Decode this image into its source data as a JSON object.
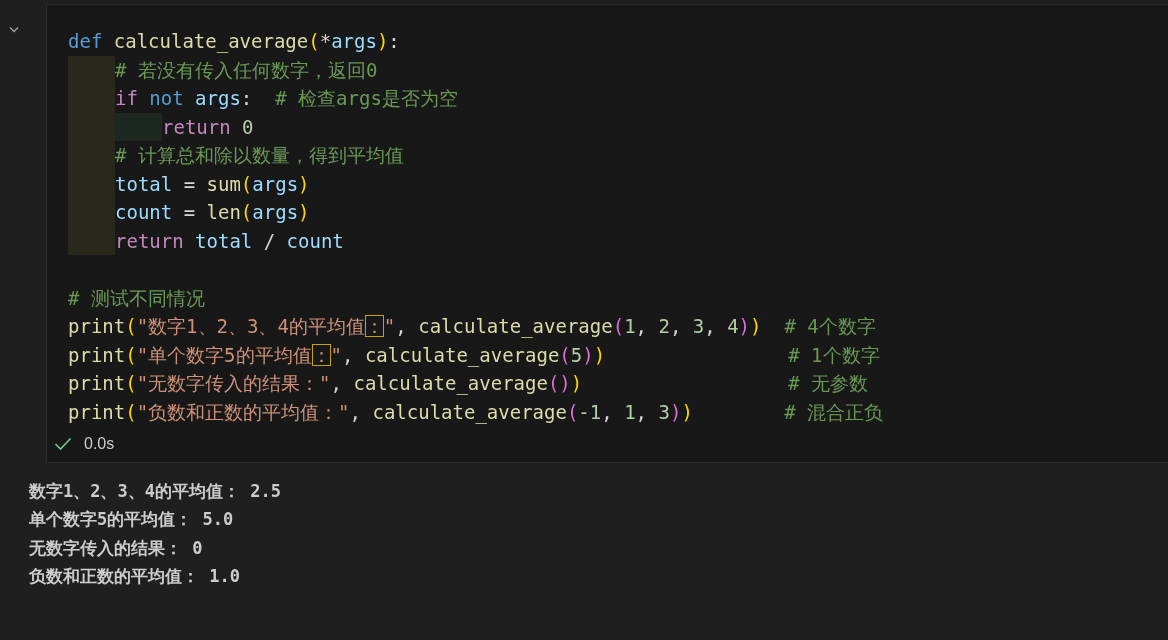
{
  "cell": {
    "blocks": [
      [
        {
          "tokens": [
            {
              "text": "def ",
              "kind": "keyword"
            },
            {
              "text": "calculate_average",
              "kind": "function"
            },
            {
              "text": "(",
              "kind": "bracket1"
            },
            {
              "text": "*",
              "kind": "punct"
            },
            {
              "text": "args",
              "kind": "variable"
            },
            {
              "text": ")",
              "kind": "bracket1"
            },
            {
              "text": ":",
              "kind": "punct"
            }
          ],
          "children": [
            {
              "tokens": [
                {
                  "text": "# 若没有传入任何数字，返回0",
                  "kind": "comment"
                }
              ]
            },
            {
              "tokens": [
                {
                  "text": "if ",
                  "kind": "control"
                },
                {
                  "text": "not ",
                  "kind": "keyword"
                },
                {
                  "text": "args",
                  "kind": "variable"
                },
                {
                  "text": ":  ",
                  "kind": "punct"
                },
                {
                  "text": "# 检查args是否为空",
                  "kind": "comment"
                }
              ],
              "children": [
                {
                  "tokens": [
                    {
                      "text": "return ",
                      "kind": "control"
                    },
                    {
                      "text": "0",
                      "kind": "number"
                    }
                  ]
                }
              ]
            },
            {
              "tokens": [
                {
                  "text": "# 计算总和除以数量，得到平均值",
                  "kind": "comment"
                }
              ]
            },
            {
              "tokens": [
                {
                  "text": "total",
                  "kind": "variable"
                },
                {
                  "text": " = ",
                  "kind": "punct"
                },
                {
                  "text": "sum",
                  "kind": "function"
                },
                {
                  "text": "(",
                  "kind": "bracket1"
                },
                {
                  "text": "args",
                  "kind": "variable"
                },
                {
                  "text": ")",
                  "kind": "bracket1"
                }
              ]
            },
            {
              "tokens": [
                {
                  "text": "count",
                  "kind": "variable"
                },
                {
                  "text": " = ",
                  "kind": "punct"
                },
                {
                  "text": "len",
                  "kind": "function"
                },
                {
                  "text": "(",
                  "kind": "bracket1"
                },
                {
                  "text": "args",
                  "kind": "variable"
                },
                {
                  "text": ")",
                  "kind": "bracket1"
                }
              ]
            },
            {
              "tokens": [
                {
                  "text": "return ",
                  "kind": "control"
                },
                {
                  "text": "total",
                  "kind": "variable"
                },
                {
                  "text": " / ",
                  "kind": "punct"
                },
                {
                  "text": "count",
                  "kind": "variable"
                }
              ]
            }
          ]
        }
      ],
      [
        {
          "tokens": [
            {
              "text": "# 测试不同情况",
              "kind": "comment"
            }
          ]
        },
        {
          "tokens": [
            {
              "text": "print",
              "kind": "function"
            },
            {
              "text": "(",
              "kind": "bracket1"
            },
            {
              "text": "\"数字1、2、3、4的平均值",
              "kind": "string"
            },
            {
              "text": "：",
              "kind": "ambiguous"
            },
            {
              "text": "\"",
              "kind": "string"
            },
            {
              "text": ", ",
              "kind": "punct"
            },
            {
              "text": "calculate_average",
              "kind": "function"
            },
            {
              "text": "(",
              "kind": "bracket2"
            },
            {
              "text": "1",
              "kind": "number"
            },
            {
              "text": ", ",
              "kind": "punct"
            },
            {
              "text": "2",
              "kind": "number"
            },
            {
              "text": ", ",
              "kind": "punct"
            },
            {
              "text": "3",
              "kind": "number"
            },
            {
              "text": ", ",
              "kind": "punct"
            },
            {
              "text": "4",
              "kind": "number"
            },
            {
              "text": ")",
              "kind": "bracket2"
            },
            {
              "text": ")",
              "kind": "bracket1"
            },
            {
              "text": "  # 4个数字",
              "kind": "comment"
            }
          ]
        },
        {
          "tokens": [
            {
              "text": "print",
              "kind": "function"
            },
            {
              "text": "(",
              "kind": "bracket1"
            },
            {
              "text": "\"单个数字5的平均值",
              "kind": "string"
            },
            {
              "text": "：",
              "kind": "ambiguous"
            },
            {
              "text": "\"",
              "kind": "string"
            },
            {
              "text": ", ",
              "kind": "punct"
            },
            {
              "text": "calculate_average",
              "kind": "function"
            },
            {
              "text": "(",
              "kind": "bracket2"
            },
            {
              "text": "5",
              "kind": "number"
            },
            {
              "text": ")",
              "kind": "bracket2"
            },
            {
              "text": ")",
              "kind": "bracket1"
            },
            {
              "text": "                # 1个数字",
              "kind": "comment"
            }
          ]
        },
        {
          "tokens": [
            {
              "text": "print",
              "kind": "function"
            },
            {
              "text": "(",
              "kind": "bracket1"
            },
            {
              "text": "\"无数字传入的结果：\"",
              "kind": "string"
            },
            {
              "text": ", ",
              "kind": "punct"
            },
            {
              "text": "calculate_average",
              "kind": "function"
            },
            {
              "text": "(",
              "kind": "bracket2"
            },
            {
              "text": ")",
              "kind": "bracket2"
            },
            {
              "text": ")",
              "kind": "bracket1"
            },
            {
              "text": "                  # 无参数",
              "kind": "comment"
            }
          ]
        },
        {
          "tokens": [
            {
              "text": "print",
              "kind": "function"
            },
            {
              "text": "(",
              "kind": "bracket1"
            },
            {
              "text": "\"负数和正数的平均值：\"",
              "kind": "string"
            },
            {
              "text": ", ",
              "kind": "punct"
            },
            {
              "text": "calculate_average",
              "kind": "function"
            },
            {
              "text": "(",
              "kind": "bracket2"
            },
            {
              "text": "-1",
              "kind": "number"
            },
            {
              "text": ", ",
              "kind": "punct"
            },
            {
              "text": "1",
              "kind": "number"
            },
            {
              "text": ", ",
              "kind": "punct"
            },
            {
              "text": "3",
              "kind": "number"
            },
            {
              "text": ")",
              "kind": "bracket2"
            },
            {
              "text": ")",
              "kind": "bracket1"
            },
            {
              "text": "        # 混合正负",
              "kind": "comment"
            }
          ]
        }
      ]
    ],
    "status": {
      "succeeded": true,
      "duration": "0.0s"
    }
  },
  "output": [
    "数字1、2、3、4的平均值： 2.5",
    "单个数字5的平均值： 5.0",
    "无数字传入的结果： 0",
    "负数和正数的平均值： 1.0"
  ]
}
